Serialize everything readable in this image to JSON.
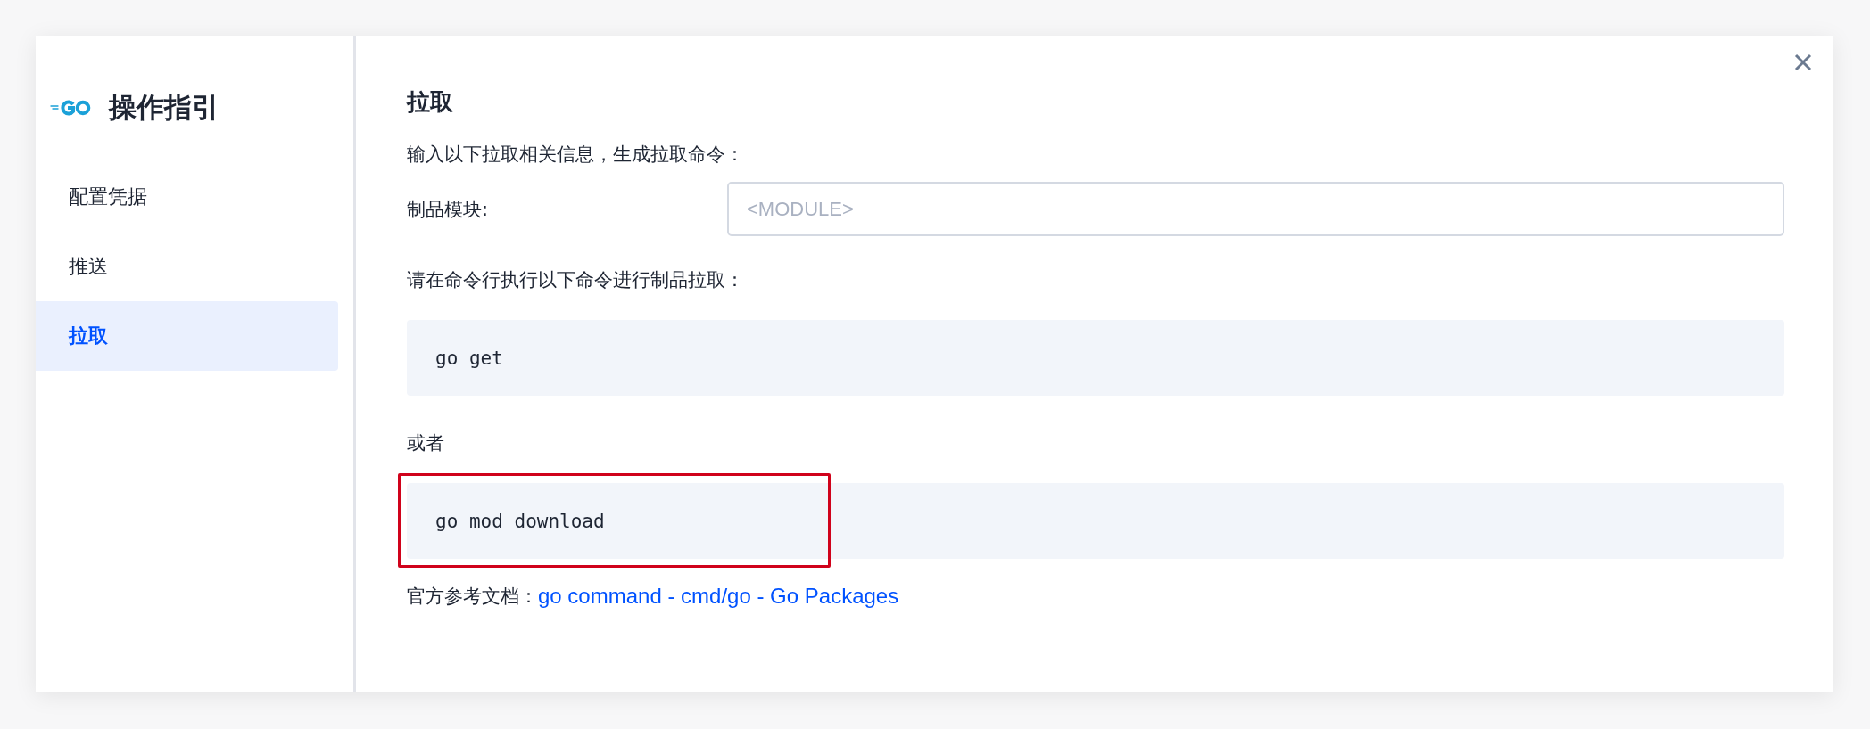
{
  "sidebar": {
    "title": "操作指引",
    "items": [
      {
        "label": "配置凭据",
        "selected": false
      },
      {
        "label": "推送",
        "selected": false
      },
      {
        "label": "拉取",
        "selected": true
      }
    ]
  },
  "content": {
    "heading": "拉取",
    "intro": "输入以下拉取相关信息，生成拉取命令：",
    "field": {
      "label": "制品模块:",
      "placeholder": "<MODULE>"
    },
    "instruction": "请在命令行执行以下命令进行制品拉取：",
    "commands": [
      {
        "text": "go get",
        "highlighted": false
      },
      {
        "text": "go mod download",
        "highlighted": true
      }
    ],
    "separator": "或者",
    "reference": {
      "label": "官方参考文档：",
      "link": "go command - cmd/go - Go Packages"
    }
  }
}
